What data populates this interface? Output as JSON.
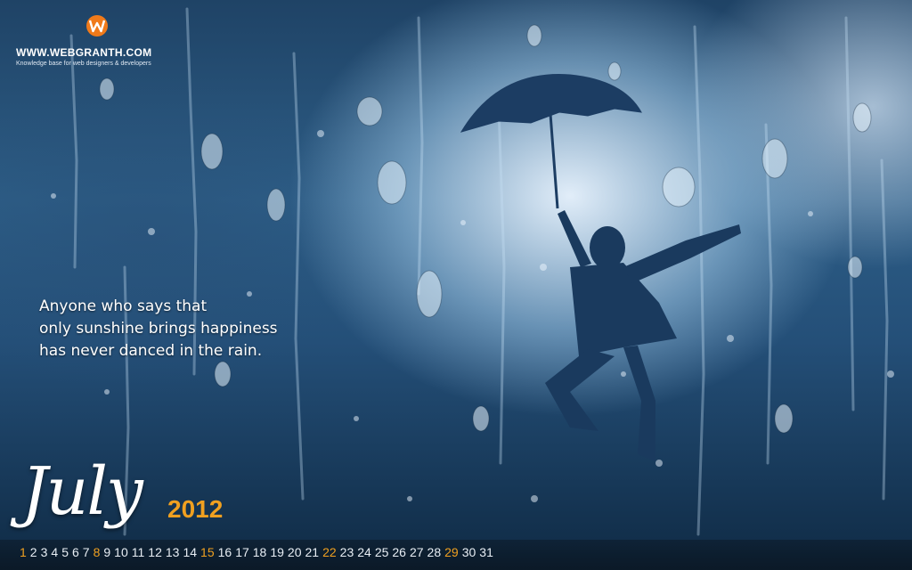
{
  "logo": {
    "icon": "webgranth-w-logo-icon",
    "site": "WWW.WEBGRANTH.COM",
    "tagline": "Knowledge base for web designers & developers",
    "colors": {
      "orange": "#f07a1a",
      "red": "#d63a1a"
    }
  },
  "quote": {
    "line1": "Anyone who says that",
    "line2": "only sunshine brings happiness",
    "line3": "has never danced in the rain."
  },
  "calendar": {
    "month": "July",
    "year": "2012",
    "days": [
      "1",
      "2",
      "3",
      "4",
      "5",
      "6",
      "7",
      "8",
      "9",
      "10",
      "11",
      "12",
      "13",
      "14",
      "15",
      "16",
      "17",
      "18",
      "19",
      "20",
      "21",
      "22",
      "23",
      "24",
      "25",
      "26",
      "27",
      "28",
      "29",
      "30",
      "31"
    ],
    "highlighted_days": [
      "1",
      "8",
      "15",
      "22",
      "29"
    ],
    "highlight_color": "#f0a020"
  }
}
